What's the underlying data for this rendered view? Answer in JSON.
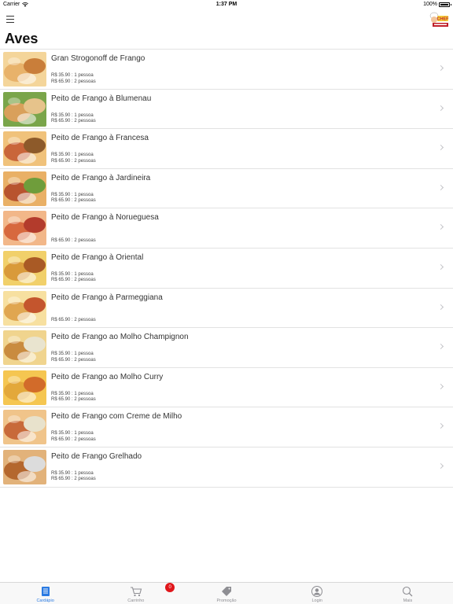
{
  "status_bar": {
    "carrier": "Carrier",
    "time": "1:37 PM",
    "battery": "100%"
  },
  "nav": {
    "title": "Aves",
    "logo_text": "CHEF"
  },
  "items": [
    {
      "title": "Gran Strogonoff de Frango",
      "prices": [
        "R$ 35.90 : 1 pessoa",
        "R$ 65.90 : 2 pessoas"
      ]
    },
    {
      "title": "Peito de Frango à Blumenau",
      "prices": [
        "R$ 35.90 : 1 pessoa",
        "R$ 65.90 : 2 pessoas"
      ]
    },
    {
      "title": "Peito de Frango à Francesa",
      "prices": [
        "R$ 35.90 : 1 pessoa",
        "R$ 65.90 : 2 pessoas"
      ]
    },
    {
      "title": "Peito de Frango à Jardineira",
      "prices": [
        "R$ 35.90 : 1 pessoa",
        "R$ 65.90 : 2 pessoas"
      ]
    },
    {
      "title": "Peito de Frango à Norueguesa",
      "prices": [
        "",
        "R$ 65.90 : 2 pessoas"
      ]
    },
    {
      "title": "Peito de Frango à Oriental",
      "prices": [
        "R$ 35.90 : 1 pessoa",
        "R$ 65.90 : 2 pessoas"
      ]
    },
    {
      "title": "Peito de Frango à Parmeggiana",
      "prices": [
        "",
        "R$ 65.90 : 2 pessoas"
      ]
    },
    {
      "title": "Peito de Frango ao Molho Champignon",
      "prices": [
        "R$ 35.90 : 1 pessoa",
        "R$ 65.90 : 2 pessoas"
      ]
    },
    {
      "title": "Peito de Frango ao Molho Curry",
      "prices": [
        "R$ 35.90 : 1 pessoa",
        "R$ 65.90 : 2 pessoas"
      ]
    },
    {
      "title": "Peito de Frango com Creme de Milho",
      "prices": [
        "R$ 35.90 : 1 pessoa",
        "R$ 65.90 : 2 pessoas"
      ]
    },
    {
      "title": "Peito de Frango Grelhado",
      "prices": [
        "R$ 35.90 : 1 pessoa",
        "R$ 65.90 : 2 pessoas"
      ]
    }
  ],
  "tabs": [
    {
      "label": "Cardápio",
      "icon": "menu-list-icon"
    },
    {
      "label": "Carrinho",
      "icon": "cart-icon"
    },
    {
      "label": "Promoção",
      "icon": "tag-icon"
    },
    {
      "label": "Login",
      "icon": "user-icon"
    },
    {
      "label": "Mais",
      "icon": "search-icon"
    }
  ],
  "cart_badge": "0",
  "colors": {
    "accent": "#2a7ae2",
    "badge": "#e0161b",
    "separator": "#e2e2e2"
  }
}
